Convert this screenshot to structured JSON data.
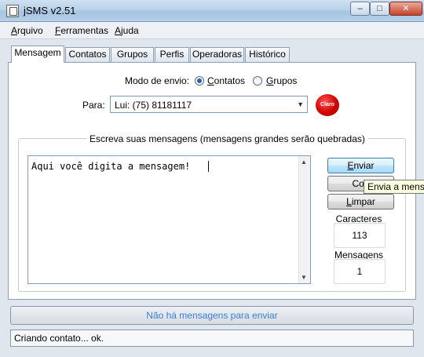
{
  "window": {
    "title": "jSMS v2.51",
    "minimize_glyph": "–",
    "maximize_glyph": "□",
    "close_glyph": "✕"
  },
  "menu": {
    "items": [
      {
        "underline": "A",
        "rest": "rquivo"
      },
      {
        "underline": "F",
        "rest": "erramentas"
      },
      {
        "underline": "A",
        "rest": "juda"
      }
    ]
  },
  "tabs": [
    "Mensagem",
    "Contatos",
    "Grupos",
    "Perfis",
    "Operadoras",
    "Histórico"
  ],
  "send_mode": {
    "label": "Modo de envio:",
    "options": [
      {
        "underline": "C",
        "rest": "ontatos",
        "selected": true
      },
      {
        "underline": "G",
        "rest": "rupos",
        "selected": false
      }
    ]
  },
  "recipient": {
    "label": "Para:",
    "value": "Lui: (75) 81181117",
    "carrier_logo_text": "Claro"
  },
  "compose": {
    "group_title": "Escreva suas mensagens (mensagens grandes serão quebradas)",
    "message_text": "Aqui você digita a mensagem!"
  },
  "buttons": {
    "send": {
      "underline": "E",
      "rest": "nviar"
    },
    "copy": {
      "underline": "",
      "rest": "Cop"
    },
    "clear": {
      "underline": "L",
      "rest": "impar"
    }
  },
  "tooltip": "Envia a mensagem",
  "counters": {
    "chars_label": "Caracteres",
    "chars_value": "113",
    "messages_label": "Mensagens",
    "messages_value": "1"
  },
  "progress_text": "Não há mensagens para enviar",
  "status_text": "Criando contato... ok.",
  "colors": {
    "accent": "#3a7fd5",
    "carrier_red": "#d10000"
  }
}
